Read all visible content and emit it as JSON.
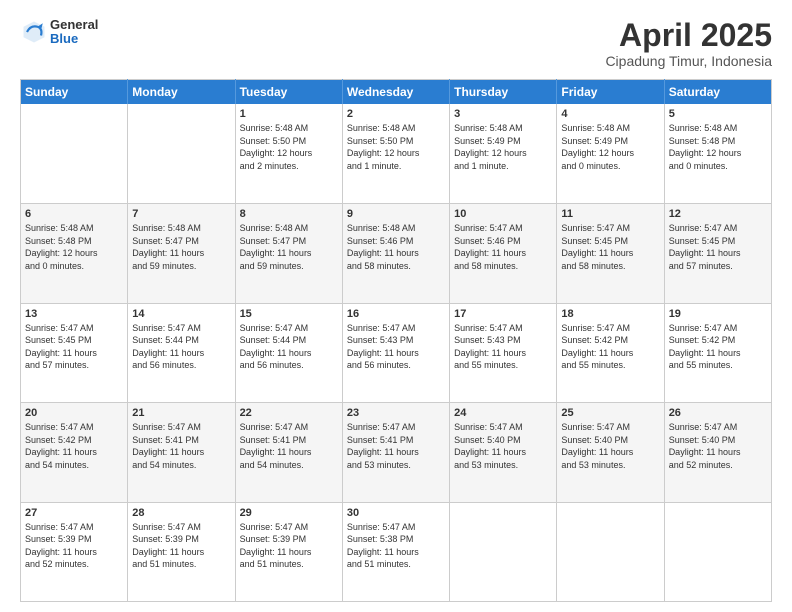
{
  "header": {
    "logo": {
      "general": "General",
      "blue": "Blue"
    },
    "title": "April 2025",
    "subtitle": "Cipadung Timur, Indonesia"
  },
  "weekdays": [
    "Sunday",
    "Monday",
    "Tuesday",
    "Wednesday",
    "Thursday",
    "Friday",
    "Saturday"
  ],
  "weeks": [
    [
      {
        "day": "",
        "info": ""
      },
      {
        "day": "",
        "info": ""
      },
      {
        "day": "1",
        "info": "Sunrise: 5:48 AM\nSunset: 5:50 PM\nDaylight: 12 hours\nand 2 minutes."
      },
      {
        "day": "2",
        "info": "Sunrise: 5:48 AM\nSunset: 5:50 PM\nDaylight: 12 hours\nand 1 minute."
      },
      {
        "day": "3",
        "info": "Sunrise: 5:48 AM\nSunset: 5:49 PM\nDaylight: 12 hours\nand 1 minute."
      },
      {
        "day": "4",
        "info": "Sunrise: 5:48 AM\nSunset: 5:49 PM\nDaylight: 12 hours\nand 0 minutes."
      },
      {
        "day": "5",
        "info": "Sunrise: 5:48 AM\nSunset: 5:48 PM\nDaylight: 12 hours\nand 0 minutes."
      }
    ],
    [
      {
        "day": "6",
        "info": "Sunrise: 5:48 AM\nSunset: 5:48 PM\nDaylight: 12 hours\nand 0 minutes."
      },
      {
        "day": "7",
        "info": "Sunrise: 5:48 AM\nSunset: 5:47 PM\nDaylight: 11 hours\nand 59 minutes."
      },
      {
        "day": "8",
        "info": "Sunrise: 5:48 AM\nSunset: 5:47 PM\nDaylight: 11 hours\nand 59 minutes."
      },
      {
        "day": "9",
        "info": "Sunrise: 5:48 AM\nSunset: 5:46 PM\nDaylight: 11 hours\nand 58 minutes."
      },
      {
        "day": "10",
        "info": "Sunrise: 5:47 AM\nSunset: 5:46 PM\nDaylight: 11 hours\nand 58 minutes."
      },
      {
        "day": "11",
        "info": "Sunrise: 5:47 AM\nSunset: 5:45 PM\nDaylight: 11 hours\nand 58 minutes."
      },
      {
        "day": "12",
        "info": "Sunrise: 5:47 AM\nSunset: 5:45 PM\nDaylight: 11 hours\nand 57 minutes."
      }
    ],
    [
      {
        "day": "13",
        "info": "Sunrise: 5:47 AM\nSunset: 5:45 PM\nDaylight: 11 hours\nand 57 minutes."
      },
      {
        "day": "14",
        "info": "Sunrise: 5:47 AM\nSunset: 5:44 PM\nDaylight: 11 hours\nand 56 minutes."
      },
      {
        "day": "15",
        "info": "Sunrise: 5:47 AM\nSunset: 5:44 PM\nDaylight: 11 hours\nand 56 minutes."
      },
      {
        "day": "16",
        "info": "Sunrise: 5:47 AM\nSunset: 5:43 PM\nDaylight: 11 hours\nand 56 minutes."
      },
      {
        "day": "17",
        "info": "Sunrise: 5:47 AM\nSunset: 5:43 PM\nDaylight: 11 hours\nand 55 minutes."
      },
      {
        "day": "18",
        "info": "Sunrise: 5:47 AM\nSunset: 5:42 PM\nDaylight: 11 hours\nand 55 minutes."
      },
      {
        "day": "19",
        "info": "Sunrise: 5:47 AM\nSunset: 5:42 PM\nDaylight: 11 hours\nand 55 minutes."
      }
    ],
    [
      {
        "day": "20",
        "info": "Sunrise: 5:47 AM\nSunset: 5:42 PM\nDaylight: 11 hours\nand 54 minutes."
      },
      {
        "day": "21",
        "info": "Sunrise: 5:47 AM\nSunset: 5:41 PM\nDaylight: 11 hours\nand 54 minutes."
      },
      {
        "day": "22",
        "info": "Sunrise: 5:47 AM\nSunset: 5:41 PM\nDaylight: 11 hours\nand 54 minutes."
      },
      {
        "day": "23",
        "info": "Sunrise: 5:47 AM\nSunset: 5:41 PM\nDaylight: 11 hours\nand 53 minutes."
      },
      {
        "day": "24",
        "info": "Sunrise: 5:47 AM\nSunset: 5:40 PM\nDaylight: 11 hours\nand 53 minutes."
      },
      {
        "day": "25",
        "info": "Sunrise: 5:47 AM\nSunset: 5:40 PM\nDaylight: 11 hours\nand 53 minutes."
      },
      {
        "day": "26",
        "info": "Sunrise: 5:47 AM\nSunset: 5:40 PM\nDaylight: 11 hours\nand 52 minutes."
      }
    ],
    [
      {
        "day": "27",
        "info": "Sunrise: 5:47 AM\nSunset: 5:39 PM\nDaylight: 11 hours\nand 52 minutes."
      },
      {
        "day": "28",
        "info": "Sunrise: 5:47 AM\nSunset: 5:39 PM\nDaylight: 11 hours\nand 51 minutes."
      },
      {
        "day": "29",
        "info": "Sunrise: 5:47 AM\nSunset: 5:39 PM\nDaylight: 11 hours\nand 51 minutes."
      },
      {
        "day": "30",
        "info": "Sunrise: 5:47 AM\nSunset: 5:38 PM\nDaylight: 11 hours\nand 51 minutes."
      },
      {
        "day": "",
        "info": ""
      },
      {
        "day": "",
        "info": ""
      },
      {
        "day": "",
        "info": ""
      }
    ]
  ]
}
